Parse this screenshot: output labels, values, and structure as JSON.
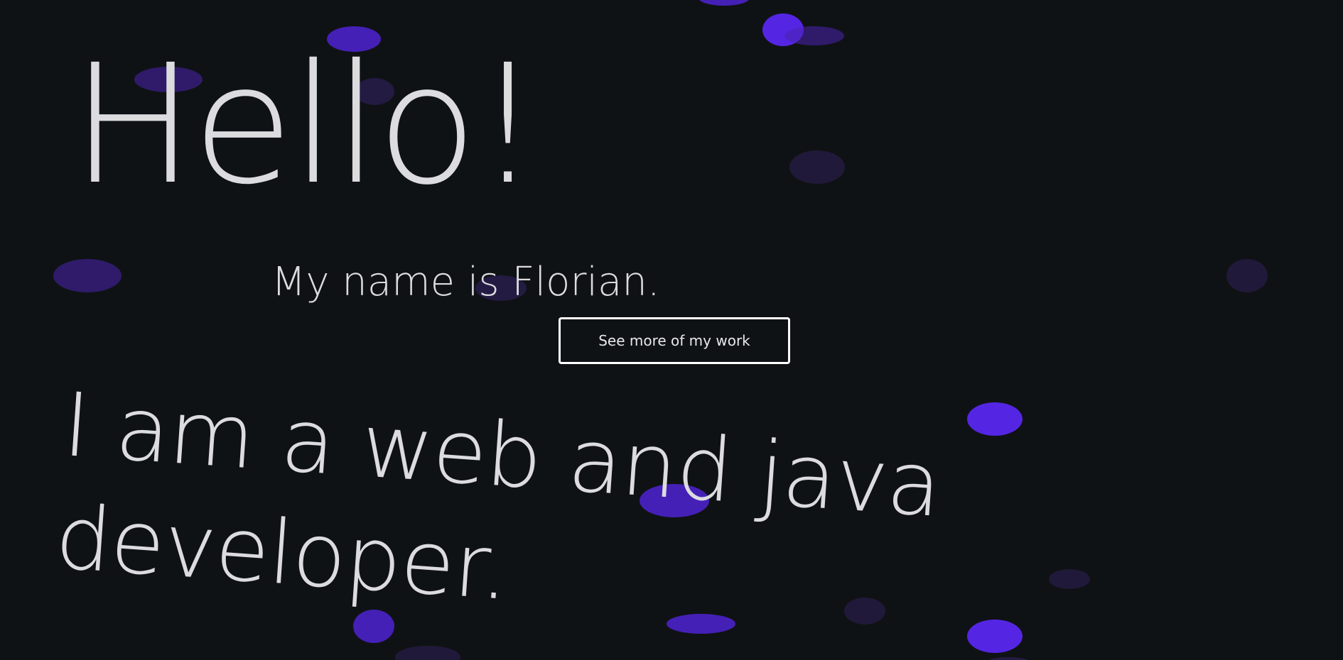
{
  "hero": {
    "greeting": "Hello!",
    "name_line": "My name is Florian.",
    "cta_label": "See more of my work",
    "tagline": "I am a web and java developer."
  },
  "colors": {
    "background": "#0f1214",
    "text": "#dcdcdf",
    "accent": "#5426e3",
    "button_border": "#ffffff"
  },
  "decor": {
    "bubble_name": "floating-purple-bubbles"
  }
}
